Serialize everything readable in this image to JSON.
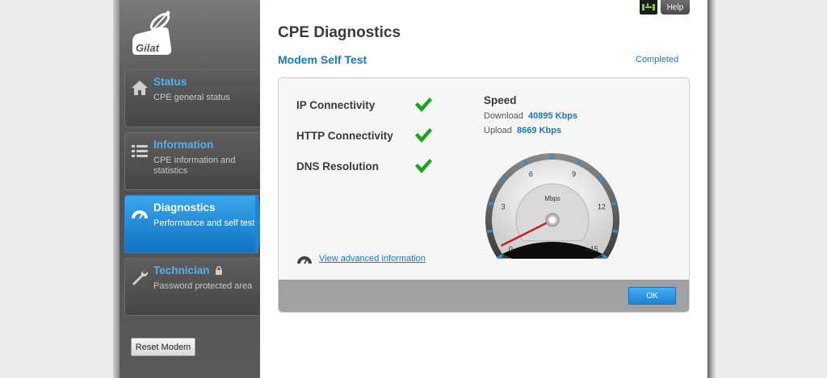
{
  "brand": {
    "logo_text": "Gilat"
  },
  "sidebar": {
    "items": [
      {
        "title": "Status",
        "desc": "CPE general status",
        "icon": "home-icon"
      },
      {
        "title": "Information",
        "desc": "CPE information and statistics",
        "icon": "list-icon"
      },
      {
        "title": "Diagnostics",
        "desc": "Performance and self test",
        "icon": "gauge-icon"
      },
      {
        "title": "Technician",
        "desc": "Password protected area",
        "icon": "wrench-icon"
      }
    ],
    "reset_label": "Reset Modem"
  },
  "header": {
    "help_label": "Help",
    "quick_icon": "network-icon"
  },
  "main": {
    "title": "CPE Diagnostics",
    "section_title": "Modem Self Test",
    "status": "Completed",
    "checks": [
      {
        "label": "IP Connectivity",
        "passed": true
      },
      {
        "label": "HTTP Connectivity",
        "passed": true
      },
      {
        "label": "DNS Resolution",
        "passed": true
      }
    ],
    "speed": {
      "title": "Speed",
      "download_label": "Download",
      "download_value": "40895 Kbps",
      "upload_label": "Upload",
      "upload_value": "8669 Kbps"
    },
    "gauge": {
      "unit": "Mbps",
      "ticks": [
        "0",
        "3",
        "6",
        "9",
        "12",
        "15"
      ],
      "value": 0.5,
      "max": 15
    },
    "advanced_link": "View advanced information",
    "ok_label": "OK"
  },
  "colors": {
    "accent": "#1a78c4",
    "nav_title": "#4fb3ee",
    "active_nav": "#1c86d6",
    "check": "#1aa51a",
    "needle": "#cc1f1f"
  }
}
